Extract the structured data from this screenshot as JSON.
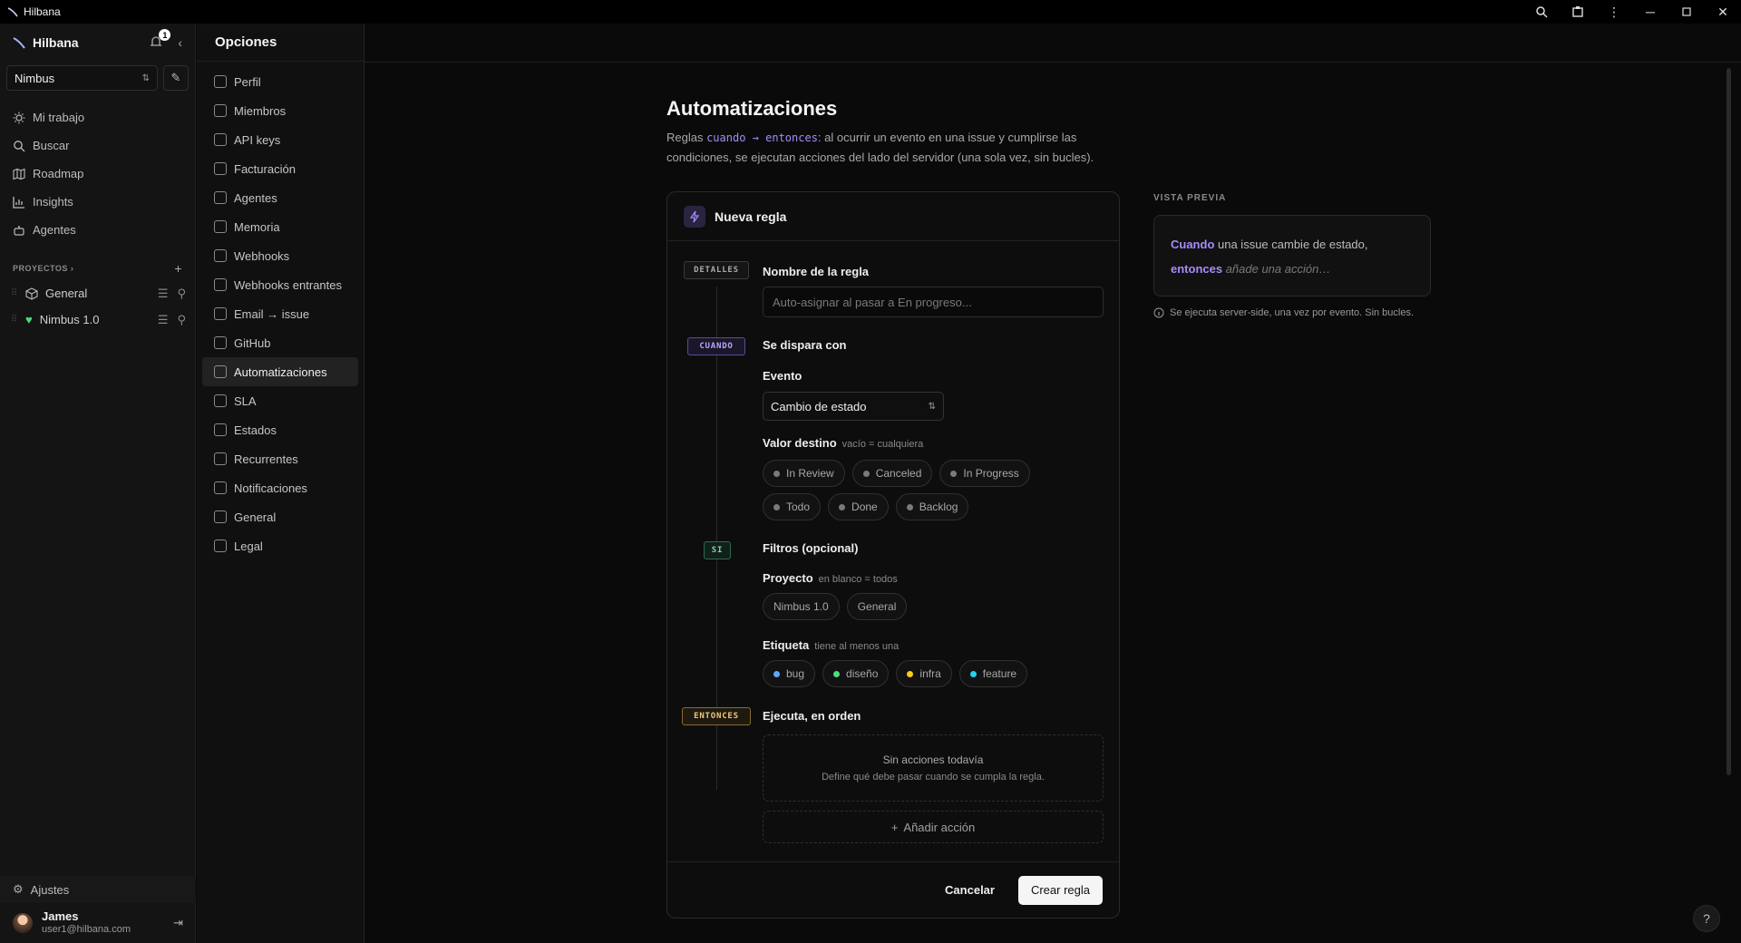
{
  "window": {
    "title": "Hilbana"
  },
  "sidebar": {
    "workspace_name": "Hilbana",
    "notification_count": "1",
    "team_select": "Nimbus",
    "nav": [
      {
        "label": "Mi trabajo",
        "icon": "sun-icon"
      },
      {
        "label": "Buscar",
        "icon": "search-icon"
      },
      {
        "label": "Roadmap",
        "icon": "map-icon"
      },
      {
        "label": "Insights",
        "icon": "chart-icon"
      },
      {
        "label": "Agentes",
        "icon": "robot-icon"
      }
    ],
    "projects_header": "PROYECTOS",
    "projects": [
      {
        "name": "General",
        "icon": "cube-icon"
      },
      {
        "name": "Nimbus 1.0",
        "icon": "heart-icon"
      }
    ],
    "settings_label": "Ajustes",
    "user": {
      "name": "James",
      "email": "user1@hilbana.com"
    }
  },
  "options": {
    "title": "Opciones",
    "items": [
      {
        "label": "Perfil",
        "icon": "user-icon"
      },
      {
        "label": "Miembros",
        "icon": "users-icon"
      },
      {
        "label": "API keys",
        "icon": "key-icon"
      },
      {
        "label": "Facturación",
        "icon": "card-icon"
      },
      {
        "label": "Agentes",
        "icon": "robot-icon"
      },
      {
        "label": "Memoria",
        "icon": "brain-icon"
      },
      {
        "label": "Webhooks",
        "icon": "webhook-icon"
      },
      {
        "label": "Webhooks entrantes",
        "icon": "inbox-icon"
      },
      {
        "label": "Email → issue",
        "icon": "mail-icon"
      },
      {
        "label": "GitHub",
        "icon": "git-branch-icon"
      },
      {
        "label": "Automatizaciones",
        "icon": "bolt-icon",
        "active": true
      },
      {
        "label": "SLA",
        "icon": "timer-icon"
      },
      {
        "label": "Estados",
        "icon": "circle-icon"
      },
      {
        "label": "Recurrentes",
        "icon": "repeat-icon"
      },
      {
        "label": "Notificaciones",
        "icon": "bell-icon"
      },
      {
        "label": "General",
        "icon": "building-icon"
      },
      {
        "label": "Legal",
        "icon": "scale-icon"
      }
    ]
  },
  "page": {
    "title": "Automatizaciones",
    "desc_prefix": "Reglas ",
    "desc_cuando": "cuando",
    "desc_arrow": " → ",
    "desc_entonces": "entonces",
    "desc_rest": ": al ocurrir un evento en una issue y cumplirse las condiciones, se ejecutan acciones del lado del servidor (una sola vez, sin bucles)."
  },
  "rule": {
    "header": "Nueva regla",
    "tags": {
      "details": "DETALLES",
      "when": "CUANDO",
      "if": "SI",
      "then": "ENTONCES"
    },
    "name_label": "Nombre de la regla",
    "name_placeholder": "Auto-asignar al pasar a En progreso...",
    "trigger_label": "Se dispara con",
    "event_label": "Evento",
    "event_value": "Cambio de estado",
    "target_label": "Valor destino",
    "target_hint": "vacío = cualquiera",
    "target_values_row1": [
      "In Review",
      "Canceled",
      "In Progress"
    ],
    "target_values_row2": [
      "Todo",
      "Done",
      "Backlog"
    ],
    "filters_label": "Filtros (opcional)",
    "project_label": "Proyecto",
    "project_hint": "en blanco = todos",
    "projects": [
      "Nimbus 1.0",
      "General"
    ],
    "label_label": "Etiqueta",
    "label_hint": "tiene al menos una",
    "labels": [
      {
        "name": "bug",
        "color": "#60a5fa"
      },
      {
        "name": "diseño",
        "color": "#4ade80"
      },
      {
        "name": "infra",
        "color": "#facc15"
      },
      {
        "name": "feature",
        "color": "#22d3ee"
      }
    ],
    "actions_label": "Ejecuta, en orden",
    "empty_title": "Sin acciones todavía",
    "empty_desc": "Define qué debe pasar cuando se cumpla la regla.",
    "add_action": "Añadir acción",
    "cancel": "Cancelar",
    "create": "Crear regla"
  },
  "preview": {
    "label": "VISTA PREVIA",
    "when": "Cuando",
    "when_text": " una issue cambie de estado,",
    "then": "entonces",
    "then_text": " añade una acción…",
    "note": "Se ejecuta server-side, una vez por evento. Sin bucles."
  },
  "colors": {
    "accent": "#a78bfa",
    "background": "#0a0a0a"
  }
}
